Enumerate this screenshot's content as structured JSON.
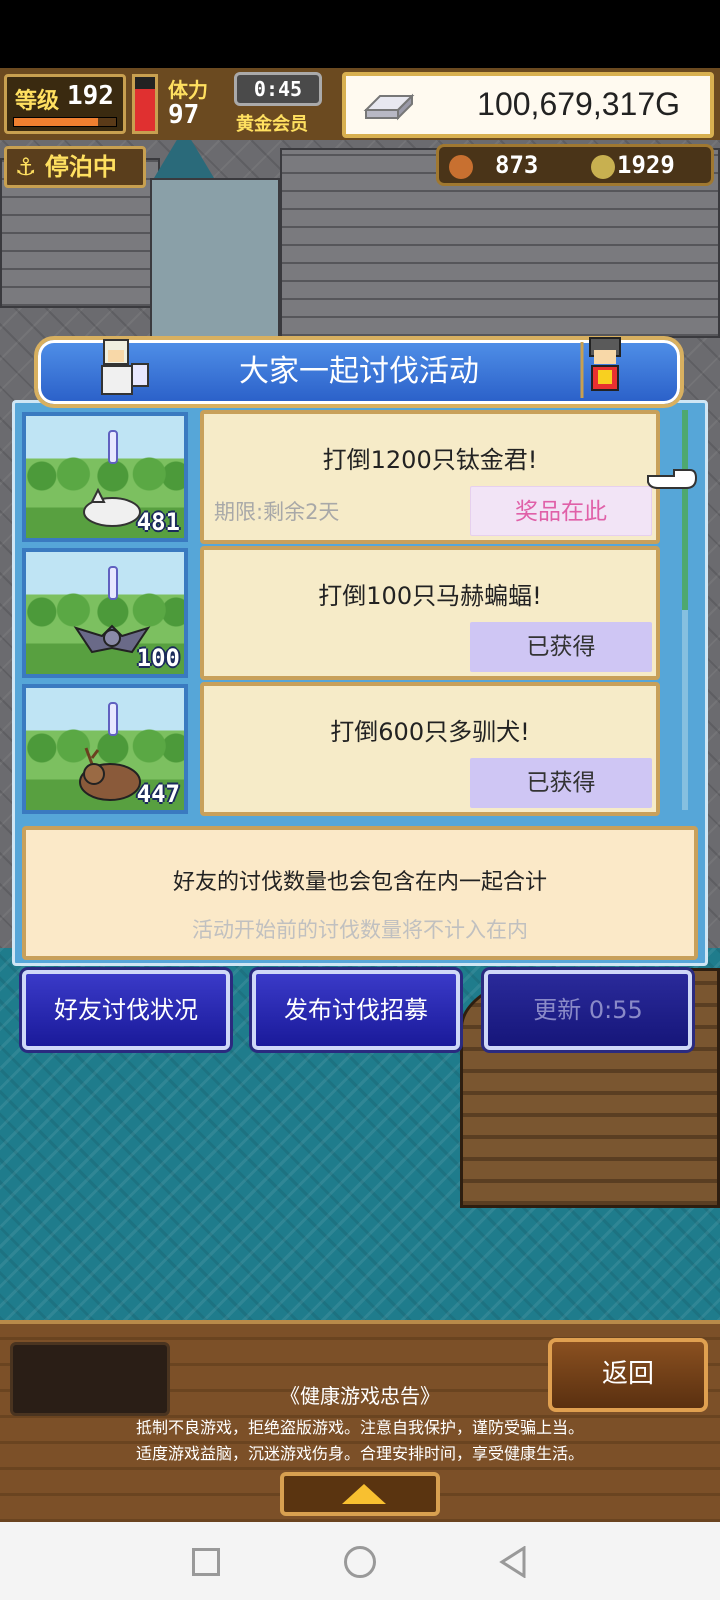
{
  "hud": {
    "level_label": "等级",
    "level": "192",
    "exp_fraction": 0.82,
    "hp_fraction": 0.78,
    "stamina_label": "体力",
    "stamina": "97",
    "timer": "0:45",
    "membership": "黄金会员",
    "gold": "100,679,317G",
    "status_docked": "停泊中",
    "resource_1": "873",
    "resource_2": "1929"
  },
  "dialog": {
    "title": "大家一起讨伐活动",
    "events": [
      {
        "title": "打倒1200只钛金君!",
        "count": "481",
        "deadline": "期限:剩余2天",
        "button": "奖品在此",
        "button_state": "prize",
        "monster_icon": "titan-monster-icon"
      },
      {
        "title": "打倒100只马赫蝙蝠!",
        "count": "100",
        "deadline": "",
        "button": "已获得",
        "button_state": "obtained",
        "monster_icon": "bat-monster-icon"
      },
      {
        "title": "打倒600只多驯犬!",
        "count": "447",
        "deadline": "",
        "button": "已获得",
        "button_state": "obtained",
        "monster_icon": "beast-monster-icon"
      }
    ],
    "note_main": "好友的讨伐数量也会包含在内一起合计",
    "note_sub": "活动开始前的讨伐数量将不计入在内",
    "buttons": {
      "friend_status": "好友讨伐状况",
      "post_recruit": "发布讨伐招募",
      "refresh": "更新 0:55"
    }
  },
  "bottom": {
    "back": "返回",
    "health_title": "《健康游戏忠告》",
    "health_line_1": "抵制不良游戏，拒绝盗版游戏。注意自我保护，谨防受骗上当。",
    "health_line_2": "适度游戏益脑，沉迷游戏伤身。合理安排时间，享受健康生活。"
  },
  "colors": {
    "dialog_blue": "#56a6d8",
    "title_blue": "#2a5fc8",
    "card_bg": "#f6ebc8",
    "prize_text": "#e060a8",
    "obtained_bg": "#cfc6f4",
    "button_blue": "#1a1a9a"
  }
}
